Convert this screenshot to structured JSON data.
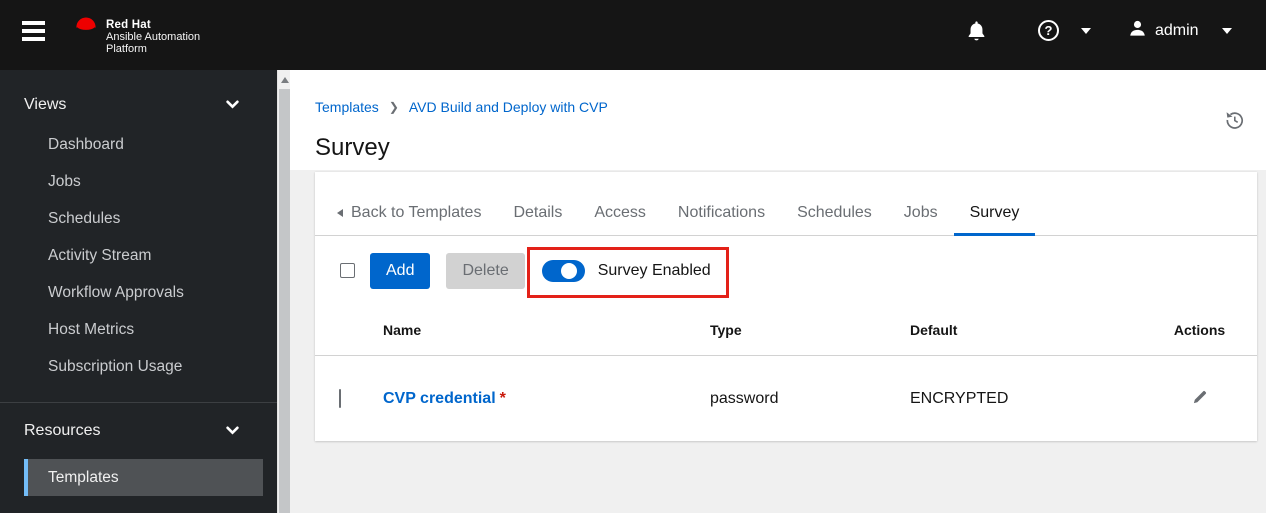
{
  "header": {
    "brand": {
      "line1": "Red Hat",
      "line2": "Ansible Automation",
      "line3": "Platform"
    },
    "help": "?",
    "user": "admin"
  },
  "sidebar": {
    "groups": [
      {
        "label": "Views",
        "items": [
          "Dashboard",
          "Jobs",
          "Schedules",
          "Activity Stream",
          "Workflow Approvals",
          "Host Metrics",
          "Subscription Usage"
        ]
      },
      {
        "label": "Resources",
        "items": [
          "Templates"
        ]
      }
    ],
    "selected_item": "Templates"
  },
  "breadcrumb": {
    "items": [
      "Templates",
      "AVD Build and Deploy with CVP"
    ]
  },
  "page": {
    "title": "Survey"
  },
  "tabs": {
    "back": "Back to Templates",
    "items": [
      "Details",
      "Access",
      "Notifications",
      "Schedules",
      "Jobs",
      "Survey"
    ],
    "active": "Survey"
  },
  "toolbar": {
    "add_label": "Add",
    "delete_label": "Delete",
    "toggle_label": "Survey Enabled",
    "toggle_on": true
  },
  "table": {
    "columns": [
      "Name",
      "Type",
      "Default",
      "Actions"
    ],
    "rows": [
      {
        "name": "CVP credential",
        "required": "*",
        "type": "password",
        "default": "ENCRYPTED"
      }
    ]
  },
  "colors": {
    "accent_blue": "#0066cc",
    "annotation_red": "#e32118",
    "selected_nav_border": "#73bcf7",
    "required_red": "#c9190b",
    "brand_red": "#ee0000"
  }
}
